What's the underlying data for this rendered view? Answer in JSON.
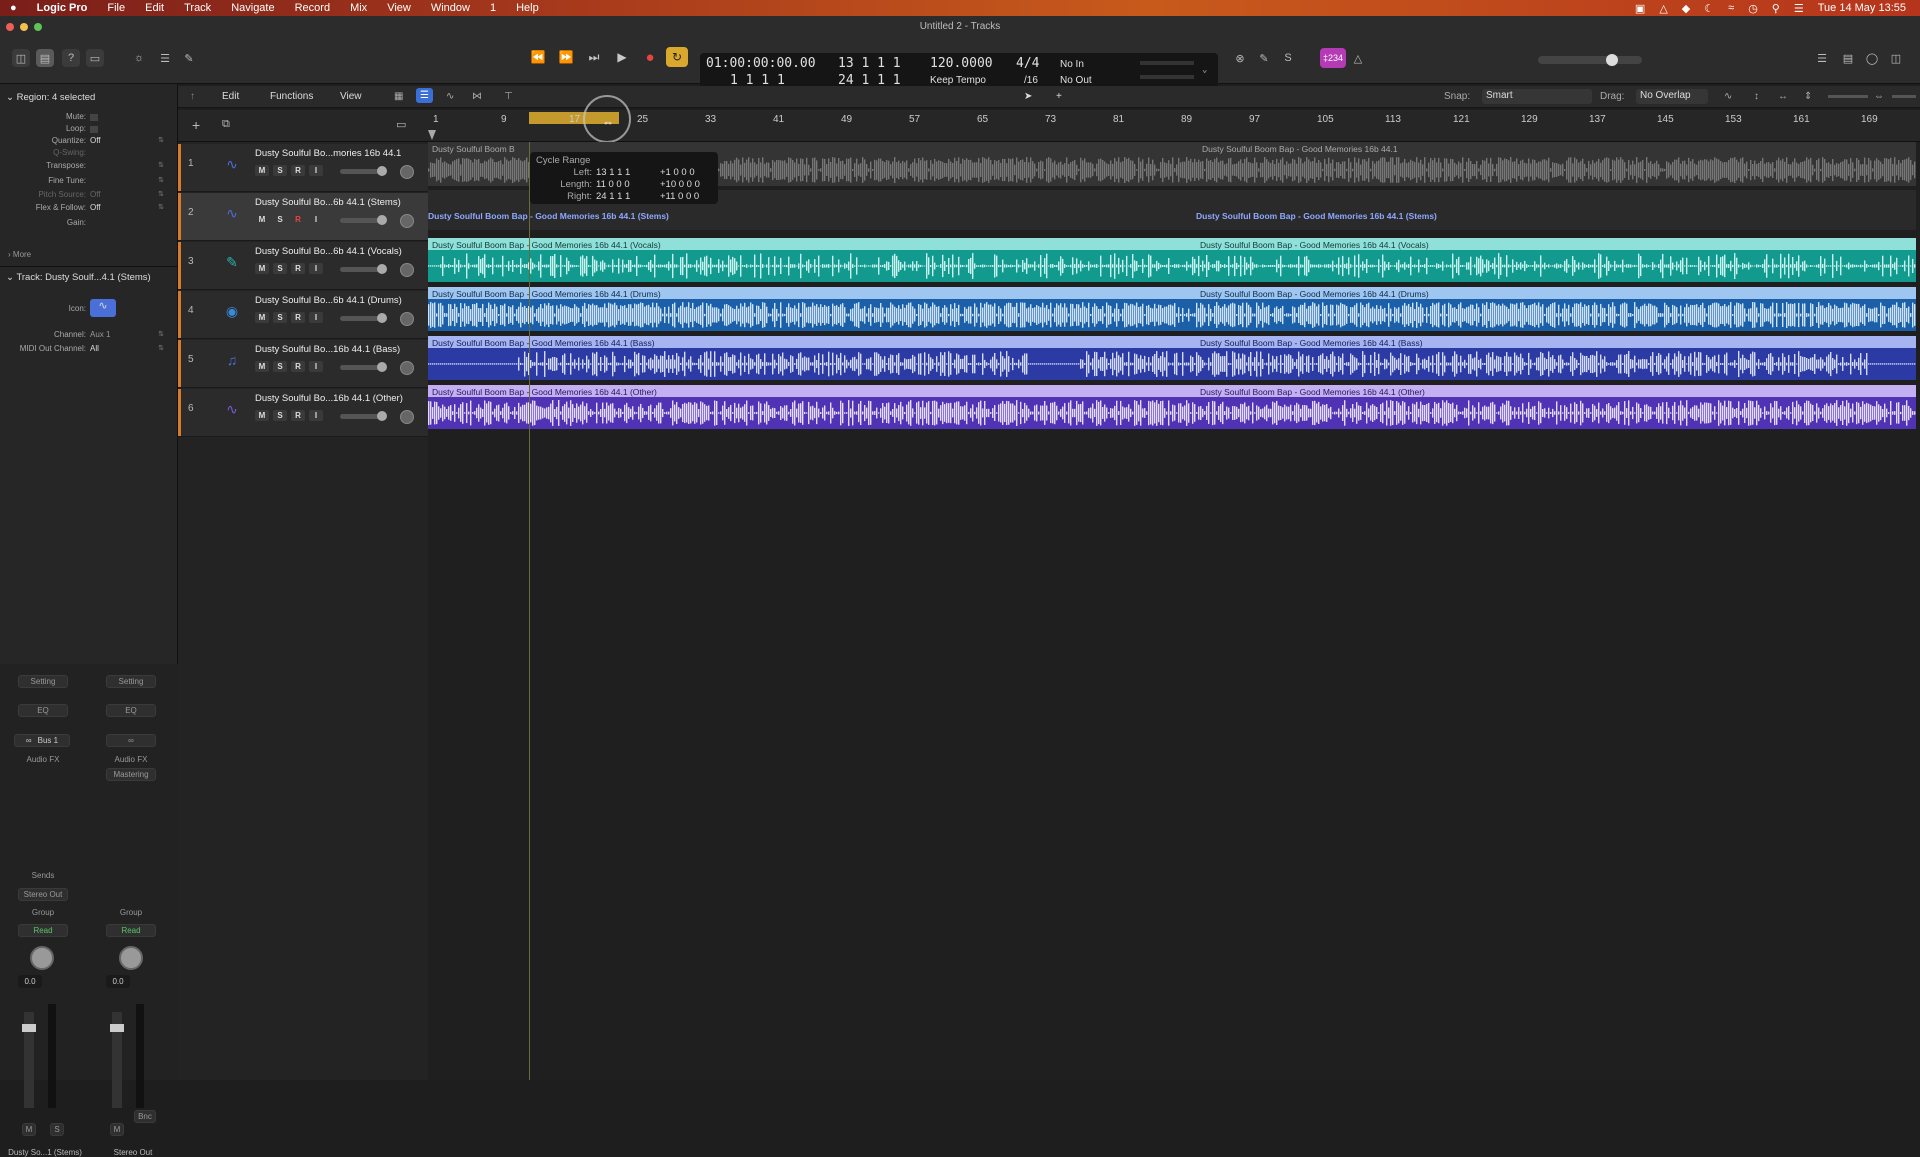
{
  "menubar": {
    "apple": "",
    "app": "Logic Pro",
    "items": [
      "File",
      "Edit",
      "Track",
      "Navigate",
      "Record",
      "Mix",
      "View",
      "Window",
      "1",
      "Help"
    ],
    "clock": "Tue 14 May  13:55"
  },
  "window": {
    "title": "Untitled 2 - Tracks"
  },
  "lcd": {
    "time": "01:00:00:00.00",
    "pos_top": "13  1  1      1",
    "pos_bottom": "1  1  1      1",
    "end_top": "",
    "end_bottom": "24  1  1      1",
    "tempo": "120.0000",
    "tempo_mode": "Keep Tempo",
    "signature": "4/4",
    "division": "/16",
    "in": "No In",
    "out": "No Out"
  },
  "badge": "‡234",
  "inspector": {
    "region_header": "Region: 4 selected",
    "rows": [
      {
        "k": "Mute:",
        "v": ""
      },
      {
        "k": "Loop:",
        "v": ""
      },
      {
        "k": "Quantize:",
        "v": "Off"
      },
      {
        "k": "Q-Swing:",
        "v": ""
      },
      {
        "k": "Transpose:",
        "v": ""
      },
      {
        "k": "Fine Tune:",
        "v": ""
      },
      {
        "k": "Pitch Source:",
        "v": "Off"
      },
      {
        "k": "Flex & Follow:",
        "v": "Off"
      },
      {
        "k": "Gain:",
        "v": ""
      }
    ],
    "more": "More",
    "track_header": "Track:",
    "track_name": "Dusty Soulf...4.1 (Stems)",
    "icon_label": "Icon:",
    "channel_label": "Channel:",
    "channel_value": "Aux 1",
    "midi_label": "MIDI Out Channel:",
    "midi_value": "All"
  },
  "strips": {
    "setting": "Setting",
    "eq": "EQ",
    "bus": "Bus 1",
    "audio_fx": "Audio FX",
    "mastering": "Mastering",
    "sends": "Sends",
    "stereo_out": "Stereo Out",
    "group": "Group",
    "read": "Read",
    "vol": "0.0",
    "bnc": "Bnc",
    "m": "M",
    "s": "S",
    "left_name": "Dusty So...1 (Stems)",
    "right_name": "Stereo Out"
  },
  "track_toolbar": {
    "edit": "Edit",
    "functions": "Functions",
    "view": "View",
    "snap_label": "Snap:",
    "snap_value": "Smart",
    "drag_label": "Drag:",
    "drag_value": "No Overlap"
  },
  "ruler": {
    "bars": [
      "1",
      "9",
      "17",
      "25",
      "33",
      "41",
      "49",
      "57",
      "65",
      "73",
      "81",
      "89",
      "97",
      "105",
      "113",
      "121",
      "129",
      "137",
      "145",
      "153",
      "161",
      "169"
    ]
  },
  "tracks": [
    {
      "num": "1",
      "name": "Dusty Soulful Bo...mories 16b 44.1",
      "color": "#4a6fd8"
    },
    {
      "num": "2",
      "name": "Dusty Soulful Bo...6b 44.1 (Stems)",
      "color": "#4a6fd8"
    },
    {
      "num": "3",
      "name": "Dusty Soulful Bo...6b 44.1 (Vocals)",
      "color": "#2ab3a8"
    },
    {
      "num": "4",
      "name": "Dusty Soulful Bo...6b 44.1 (Drums)",
      "color": "#3a8ad8"
    },
    {
      "num": "5",
      "name": "Dusty Soulful Bo...16b 44.1 (Bass)",
      "color": "#4a6fd8"
    },
    {
      "num": "6",
      "name": "Dusty Soulful Bo...16b 44.1 (Other)",
      "color": "#7a5ad8"
    }
  ],
  "msri": [
    "M",
    "S",
    "R",
    "I"
  ],
  "regions": {
    "r1a": "Dusty Soulful Boom B",
    "r1b": "Dusty Soulful Boom Bap - Good Memories 16b 44.1",
    "stems": "Dusty Soulful Boom Bap - Good Memories 16b 44.1 (Stems)",
    "vocals": "Dusty Soulful Boom Bap - Good Memories 16b 44.1 (Vocals)",
    "drums": "Dusty Soulful Boom Bap - Good Memories 16b 44.1 (Drums)",
    "bass": "Dusty Soulful Boom Bap - Good Memories 16b 44.1 (Bass)",
    "other": "Dusty Soulful Boom Bap - Good Memories 16b 44.1 (Other)"
  },
  "tooltip": {
    "title": "Cycle Range",
    "left_label": "Left:",
    "left_value": "13 1 1 1",
    "left_delta": "+1 0 0 0",
    "length_label": "Length:",
    "length_value": "11 0 0 0",
    "length_delta": "+10 0 0 0",
    "right_label": "Right:",
    "right_value": "24 1 1 1",
    "right_delta": "+11 0 0 0"
  }
}
